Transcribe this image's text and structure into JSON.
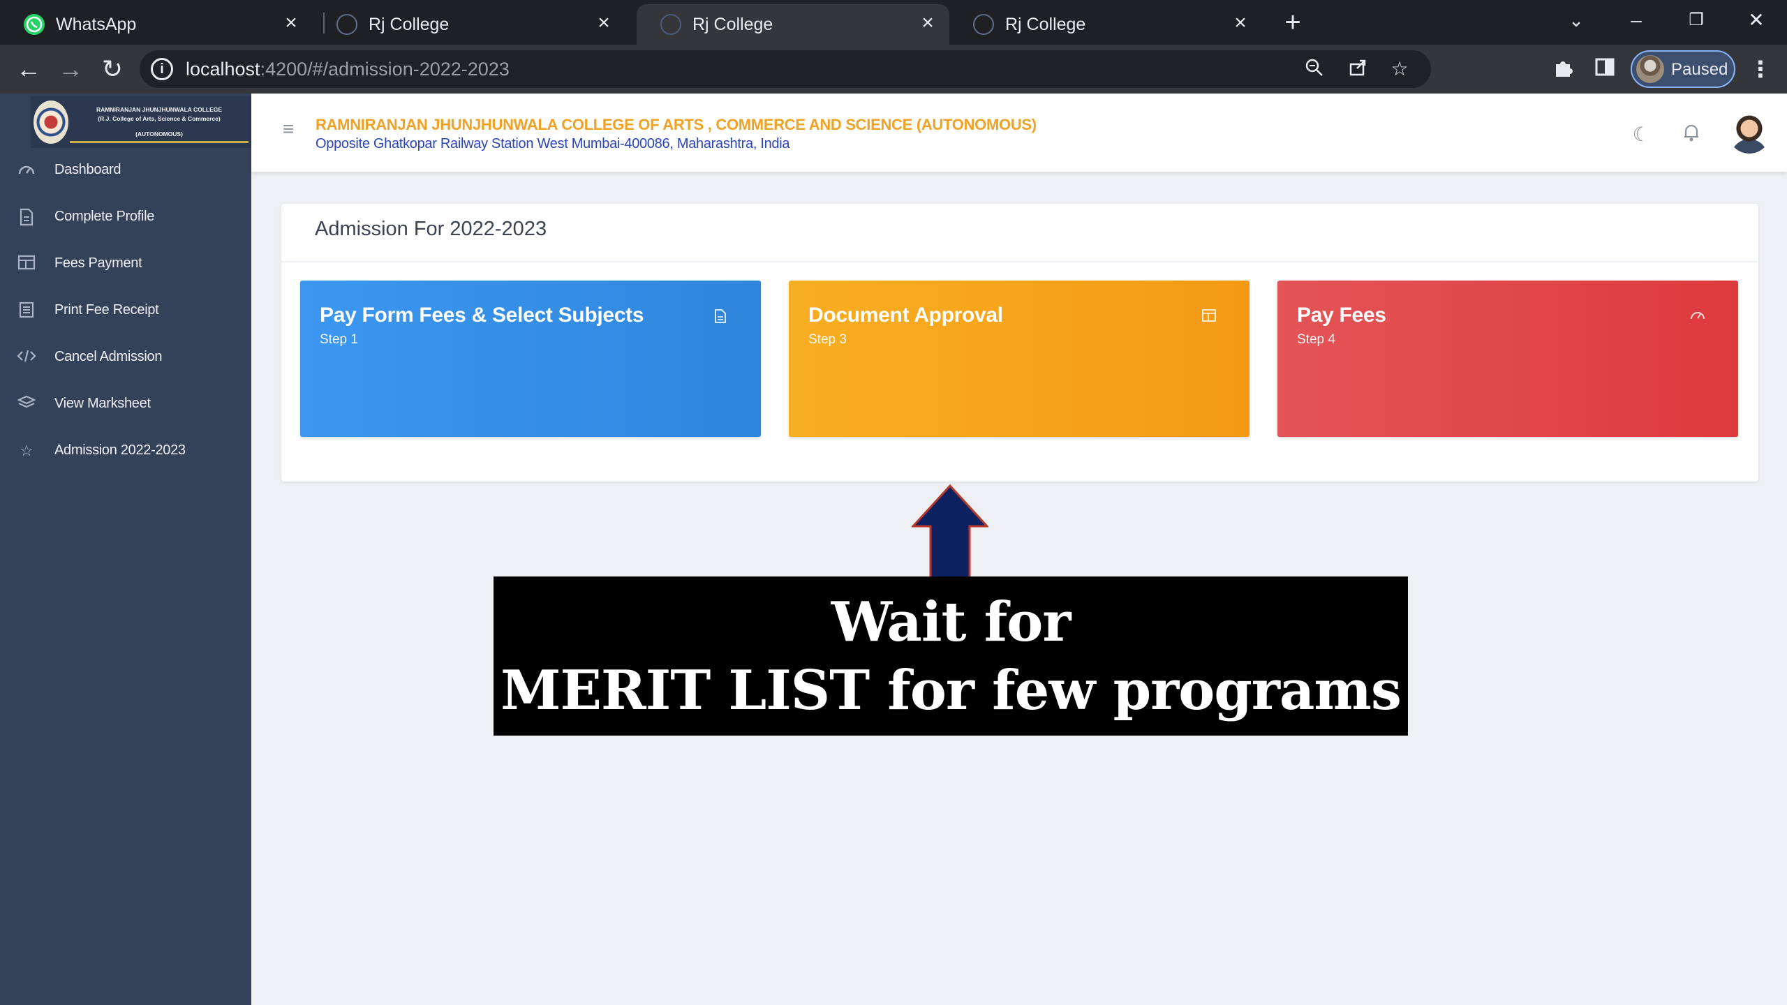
{
  "browser": {
    "tabs": [
      {
        "title": "WhatsApp",
        "icon": "whatsapp-icon",
        "active": false
      },
      {
        "title": "Rj College",
        "icon": "college-favicon-icon",
        "active": false
      },
      {
        "title": "Rj College",
        "icon": "college-favicon-icon",
        "active": true
      },
      {
        "title": "Rj College",
        "icon": "college-favicon-icon",
        "active": false
      }
    ],
    "url_host": "localhost",
    "url_rest": ":4200/#/admission-2022-2023",
    "profile_label": "Paused"
  },
  "logo": {
    "lines": [
      "RAMNIRANJAN JHUNJHUNWALA COLLEGE",
      "(R.J. College of Arts, Science & Commerce)",
      "(AUTONOMOUS)"
    ]
  },
  "sidebar": {
    "items": [
      {
        "label": "Dashboard",
        "icon": "dashboard-gauge-icon"
      },
      {
        "label": "Complete Profile",
        "icon": "document-icon"
      },
      {
        "label": "Fees Payment",
        "icon": "table-icon"
      },
      {
        "label": "Print Fee Receipt",
        "icon": "receipt-icon"
      },
      {
        "label": "Cancel Admission",
        "icon": "code-icon"
      },
      {
        "label": "View Marksheet",
        "icon": "layers-icon"
      },
      {
        "label": "Admission 2022-2023",
        "icon": "star-icon"
      }
    ]
  },
  "header": {
    "college_name": "RAMNIRANJAN JHUNJHUNWALA COLLEGE OF ARTS , COMMERCE AND SCIENCE (AUTONOMOUS)",
    "college_address": "Opposite Ghatkopar Railway Station West Mumbai-400086, Maharashtra, India"
  },
  "main": {
    "card_title": "Admission For 2022-2023",
    "steps": [
      {
        "title": "Pay Form Fees & Select Subjects",
        "subtitle": "Step 1",
        "icon": "document-icon",
        "color": "#3a93ec"
      },
      {
        "title": "Document Approval",
        "subtitle": "Step 3",
        "icon": "table-icon",
        "color": "#f7a41b"
      },
      {
        "title": "Pay Fees",
        "subtitle": "Step 4",
        "icon": "dashboard-gauge-icon",
        "color": "#e0484a"
      }
    ]
  },
  "overlay": {
    "caption_line1": "Wait for",
    "caption_line2": "MERIT LIST for few programs",
    "arrow_color": "#0d2160",
    "arrow_outline": "#b5382b"
  }
}
